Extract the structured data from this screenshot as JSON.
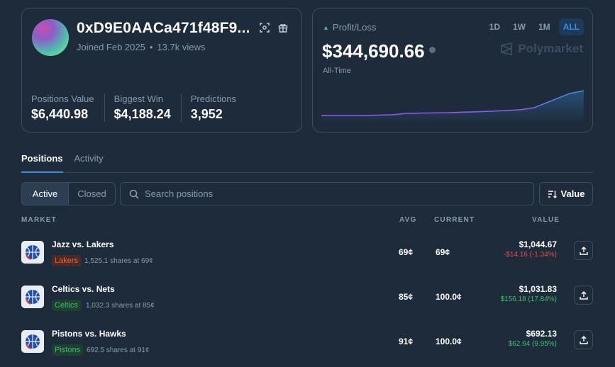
{
  "profile": {
    "username": "0xD9E0AACa471f48F9...",
    "joined": "Joined Feb 2025",
    "views": "13.7k views",
    "stats": [
      {
        "label": "Positions Value",
        "value": "$6,440.98"
      },
      {
        "label": "Biggest Win",
        "value": "$4,188.24"
      },
      {
        "label": "Predictions",
        "value": "3,952"
      }
    ],
    "icons": [
      "scan-icon",
      "gift-icon"
    ]
  },
  "pl": {
    "label": "Profit/Loss",
    "value": "$344,690.66",
    "sub": "All-Time",
    "brand": "Polymarket",
    "ranges": [
      "1D",
      "1W",
      "1M",
      "ALL"
    ],
    "active_range": "ALL",
    "line_color": "#8b5cf6",
    "line_color_end": "#3d8fe0"
  },
  "tabs": [
    {
      "label": "Positions",
      "active": true
    },
    {
      "label": "Activity",
      "active": false
    }
  ],
  "filter": {
    "segments": [
      {
        "label": "Active",
        "active": true
      },
      {
        "label": "Closed",
        "active": false
      }
    ],
    "search_placeholder": "Search positions",
    "sort_label": "Value"
  },
  "table": {
    "headers": {
      "market": "MARKET",
      "avg": "AVG",
      "current": "CURRENT",
      "value": "VALUE"
    },
    "rows": [
      {
        "market": "Jazz vs. Lakers",
        "outcome": "Lakers",
        "outcome_color": "red",
        "shares": "1,525.1 shares at 69¢",
        "avg": "69¢",
        "current": "69¢",
        "value": "$1,044.67",
        "pnl": "-$14.16 (-1.34%)",
        "pnl_sign": "neg"
      },
      {
        "market": "Celtics vs. Nets",
        "outcome": "Celtics",
        "outcome_color": "green",
        "shares": "1,032.3 shares at 85¢",
        "avg": "85¢",
        "current": "100.0¢",
        "value": "$1,031.83",
        "pnl": "$156.18 (17.84%)",
        "pnl_sign": "pos"
      },
      {
        "market": "Pistons vs. Hawks",
        "outcome": "Pistons",
        "outcome_color": "green",
        "shares": "692.5 shares at 91¢",
        "avg": "91¢",
        "current": "100.0¢",
        "value": "$692.13",
        "pnl": "$62.64 (9.95%)",
        "pnl_sign": "pos"
      }
    ]
  },
  "colors": {
    "background": "#1d2b3a",
    "accent": "#3d8fe0",
    "positive": "#3dbd6d",
    "negative": "#e84d4d",
    "muted": "#8a9bb0"
  }
}
